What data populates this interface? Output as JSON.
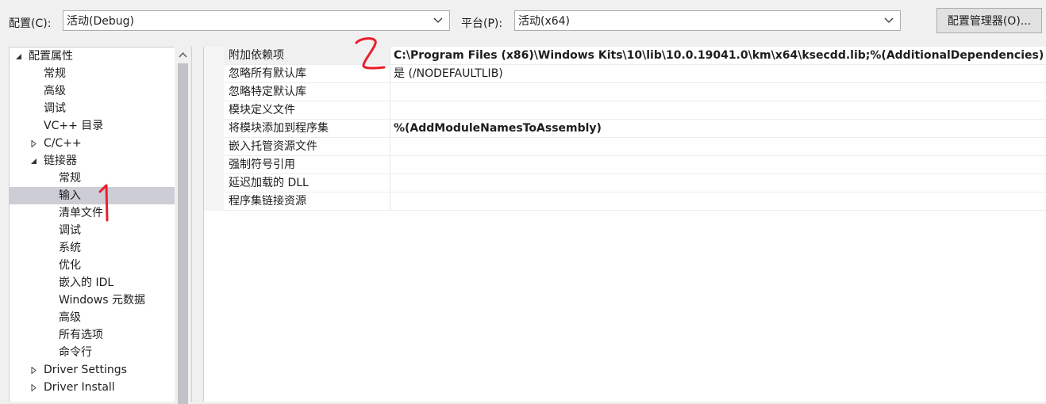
{
  "toolbar": {
    "config_label": "配置(C):",
    "config_value": "活动(Debug)",
    "platform_label": "平台(P):",
    "platform_value": "活动(x64)",
    "manager_button": "配置管理器(O)..."
  },
  "tree": {
    "items": [
      {
        "label": "配置属性",
        "expander": "expanded"
      },
      {
        "label": "常规"
      },
      {
        "label": "高级"
      },
      {
        "label": "调试"
      },
      {
        "label": "VC++ 目录"
      },
      {
        "label": "C/C++",
        "expander": "collapsed"
      },
      {
        "label": "链接器",
        "expander": "expanded"
      },
      {
        "label": "常规"
      },
      {
        "label": "输入",
        "selected": true
      },
      {
        "label": "清单文件"
      },
      {
        "label": "调试"
      },
      {
        "label": "系统"
      },
      {
        "label": "优化"
      },
      {
        "label": "嵌入的 IDL"
      },
      {
        "label": "Windows 元数据"
      },
      {
        "label": "高级"
      },
      {
        "label": "所有选项"
      },
      {
        "label": "命令行"
      },
      {
        "label": "Driver Settings",
        "expander": "collapsed"
      },
      {
        "label": "Driver Install",
        "expander": "collapsed"
      }
    ]
  },
  "properties": [
    {
      "name": "附加依赖项",
      "value": "C:\\Program Files (x86)\\Windows Kits\\10\\lib\\10.0.19041.0\\km\\x64\\ksecdd.lib;%(AdditionalDependencies)",
      "bold": true
    },
    {
      "name": "忽略所有默认库",
      "value": "是 (/NODEFAULTLIB)",
      "bold": false
    },
    {
      "name": "忽略特定默认库",
      "value": "",
      "bold": false
    },
    {
      "name": "模块定义文件",
      "value": "",
      "bold": false
    },
    {
      "name": "将模块添加到程序集",
      "value": "%(AddModuleNamesToAssembly)",
      "bold": true
    },
    {
      "name": "嵌入托管资源文件",
      "value": "",
      "bold": false
    },
    {
      "name": "强制符号引用",
      "value": "",
      "bold": false
    },
    {
      "name": "延迟加载的 DLL",
      "value": "",
      "bold": false
    },
    {
      "name": "程序集链接资源",
      "value": "",
      "bold": false
    }
  ],
  "colors": {
    "selection": "#cdcdd6",
    "annotation": "#e8202a"
  }
}
